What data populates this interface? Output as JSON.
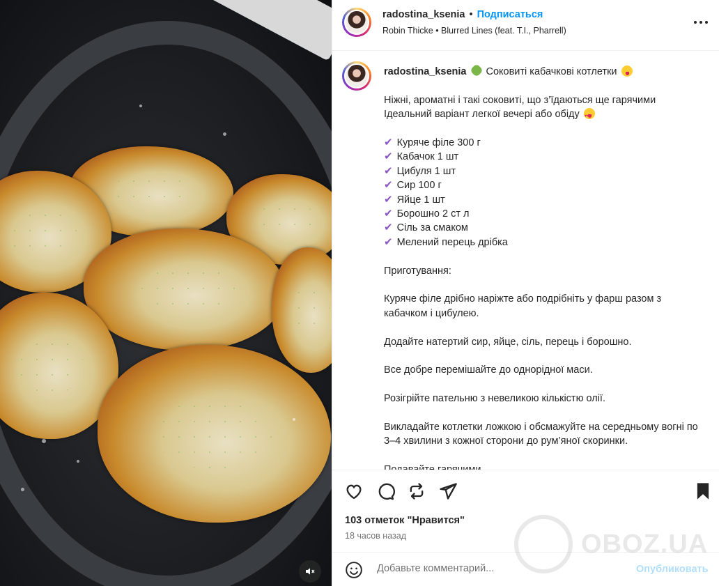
{
  "header": {
    "username": "radostina_ksenia",
    "separator": "•",
    "follow_label": "Подписаться",
    "audio": "Robin Thicke • Blurred Lines (feat. T.I., Pharrell)"
  },
  "caption": {
    "username": "radostina_ksenia",
    "title": "Соковиті кабачкові котлетки",
    "lines": [
      "Ніжні, ароматні і такі соковиті, що з’їдаються ще гарячими",
      "Ідеальний варіант легкої вечері або обіду"
    ],
    "ingredients": [
      "Куряче філе 300 г",
      "Кабачок 1 шт",
      "Цибуля 1 шт",
      "Сир 100 г",
      "Яйце 1 шт",
      "Борошно 2 ст л",
      "Сіль за смаком",
      "Мелений перець дрібка"
    ],
    "prep_heading": "Приготування:",
    "steps": [
      "Куряче філе дрібно наріжте або подрібніть у фарш разом з кабачком і цибулею.",
      "Додайте натертий сир, яйце, сіль, перець і борошно.",
      "Все добре перемішайте до однорідної маси.",
      "Розігрійте пательню з невеликою кількістю олії.",
      "Викладайте котлетки ложкою і обсмажуйте на середньому вогні по 3–4 хвилини з кожної сторони до рум’яної скоринки.",
      "Подавайте гарячими"
    ]
  },
  "stats": {
    "likes": "103 отметок \"Нравится\"",
    "time": "18 часов назад"
  },
  "comment": {
    "placeholder": "Добавьте комментарий...",
    "publish_label": "Опубликовать"
  },
  "watermark": {
    "text": "OBOZ.UA"
  },
  "icons": [
    "more-icon",
    "mute-icon",
    "heart-icon",
    "comment-icon",
    "repost-icon",
    "share-icon",
    "bookmark-icon",
    "emoji-icon"
  ]
}
